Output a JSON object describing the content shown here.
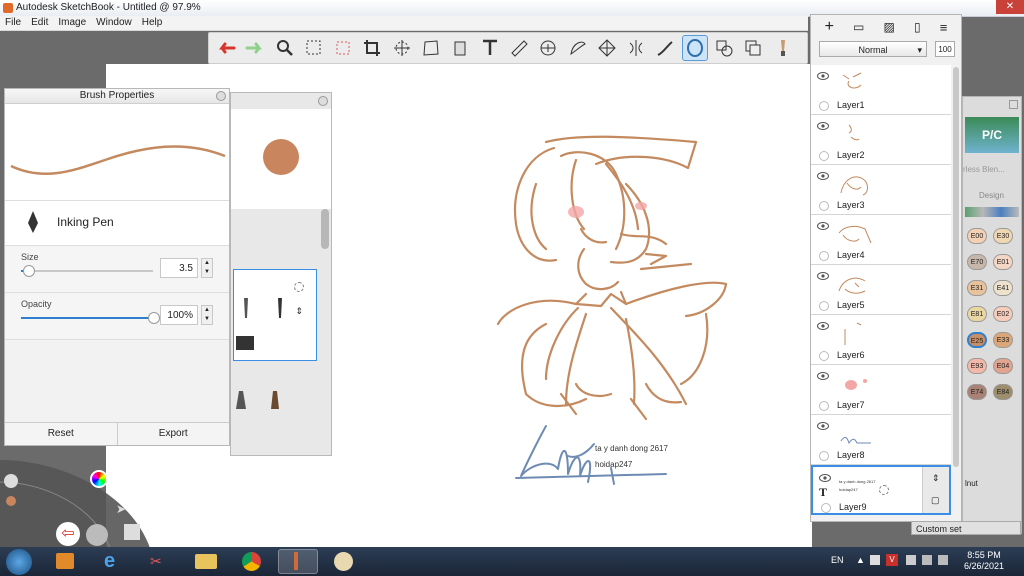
{
  "window": {
    "title": "Autodesk SketchBook - Untitled @ 97.9%"
  },
  "menu": {
    "items": [
      "File",
      "Edit",
      "Image",
      "Window",
      "Help"
    ]
  },
  "toolbar": {
    "icons": [
      "undo-icon",
      "redo-icon",
      "zoom-icon",
      "rect-select-icon",
      "lasso-icon",
      "crop-icon",
      "transform-icon",
      "distort-icon",
      "fill-icon",
      "text-icon",
      "ruler-icon",
      "ellipse-guide-icon",
      "french-curve-icon",
      "perspective-icon",
      "symmetry-icon",
      "stroke-icon",
      "ellipse-icon",
      "shapes-icon",
      "copy-icon",
      "brush-icon"
    ],
    "selected_index": 16
  },
  "brush_properties": {
    "title": "Brush Properties",
    "brush_name": "Inking Pen",
    "size_label": "Size",
    "size_value": "3.5",
    "size_fraction": 0.05,
    "opacity_label": "Opacity",
    "opacity_value": "100%",
    "opacity_fraction": 1.0,
    "reset_label": "Reset",
    "export_label": "Export",
    "stroke_color": "#c48a5f"
  },
  "brush_palette": {
    "color": "#c8855e"
  },
  "layers_panel": {
    "blend_mode": "Normal",
    "opacity": "100",
    "layers": [
      {
        "name": "Layer1"
      },
      {
        "name": "Layer2"
      },
      {
        "name": "Layer3"
      },
      {
        "name": "Layer4"
      },
      {
        "name": "Layer5"
      },
      {
        "name": "Layer6"
      },
      {
        "name": "Layer7"
      },
      {
        "name": "Layer8"
      },
      {
        "name": "Layer9"
      }
    ],
    "selected_index": 8
  },
  "copic": {
    "logo": "P/C",
    "subtitle": "rless Blen...",
    "design_label": "Design",
    "swatches": [
      {
        "code": "E00",
        "color": "#f4d0b5"
      },
      {
        "code": "E30",
        "color": "#efd7b4"
      },
      {
        "code": "E70",
        "color": "#c7b7aa"
      },
      {
        "code": "E01",
        "color": "#f5d6c4"
      },
      {
        "code": "E31",
        "color": "#e8c29a"
      },
      {
        "code": "E41",
        "color": "#efe2cc"
      },
      {
        "code": "E81",
        "color": "#e9d6a3"
      },
      {
        "code": "E02",
        "color": "#f6cdbb"
      },
      {
        "code": "E25",
        "color": "#c98e66"
      },
      {
        "code": "E33",
        "color": "#dca679"
      },
      {
        "code": "E93",
        "color": "#f3b8a7"
      },
      {
        "code": "E04",
        "color": "#e3a48f"
      },
      {
        "code": "E74",
        "color": "#a98275"
      },
      {
        "code": "E84",
        "color": "#9e8e6b"
      }
    ],
    "name_label": "lnut",
    "custom_set": "Custom set"
  },
  "canvas": {
    "text1": "ta y danh dong 2617",
    "text2": "hoidap247",
    "ink": "#c48a5f",
    "signature_ink": "#6e8bb3"
  },
  "taskbar": {
    "lang": "EN",
    "time": "8:55 PM",
    "date": "6/26/2021"
  }
}
